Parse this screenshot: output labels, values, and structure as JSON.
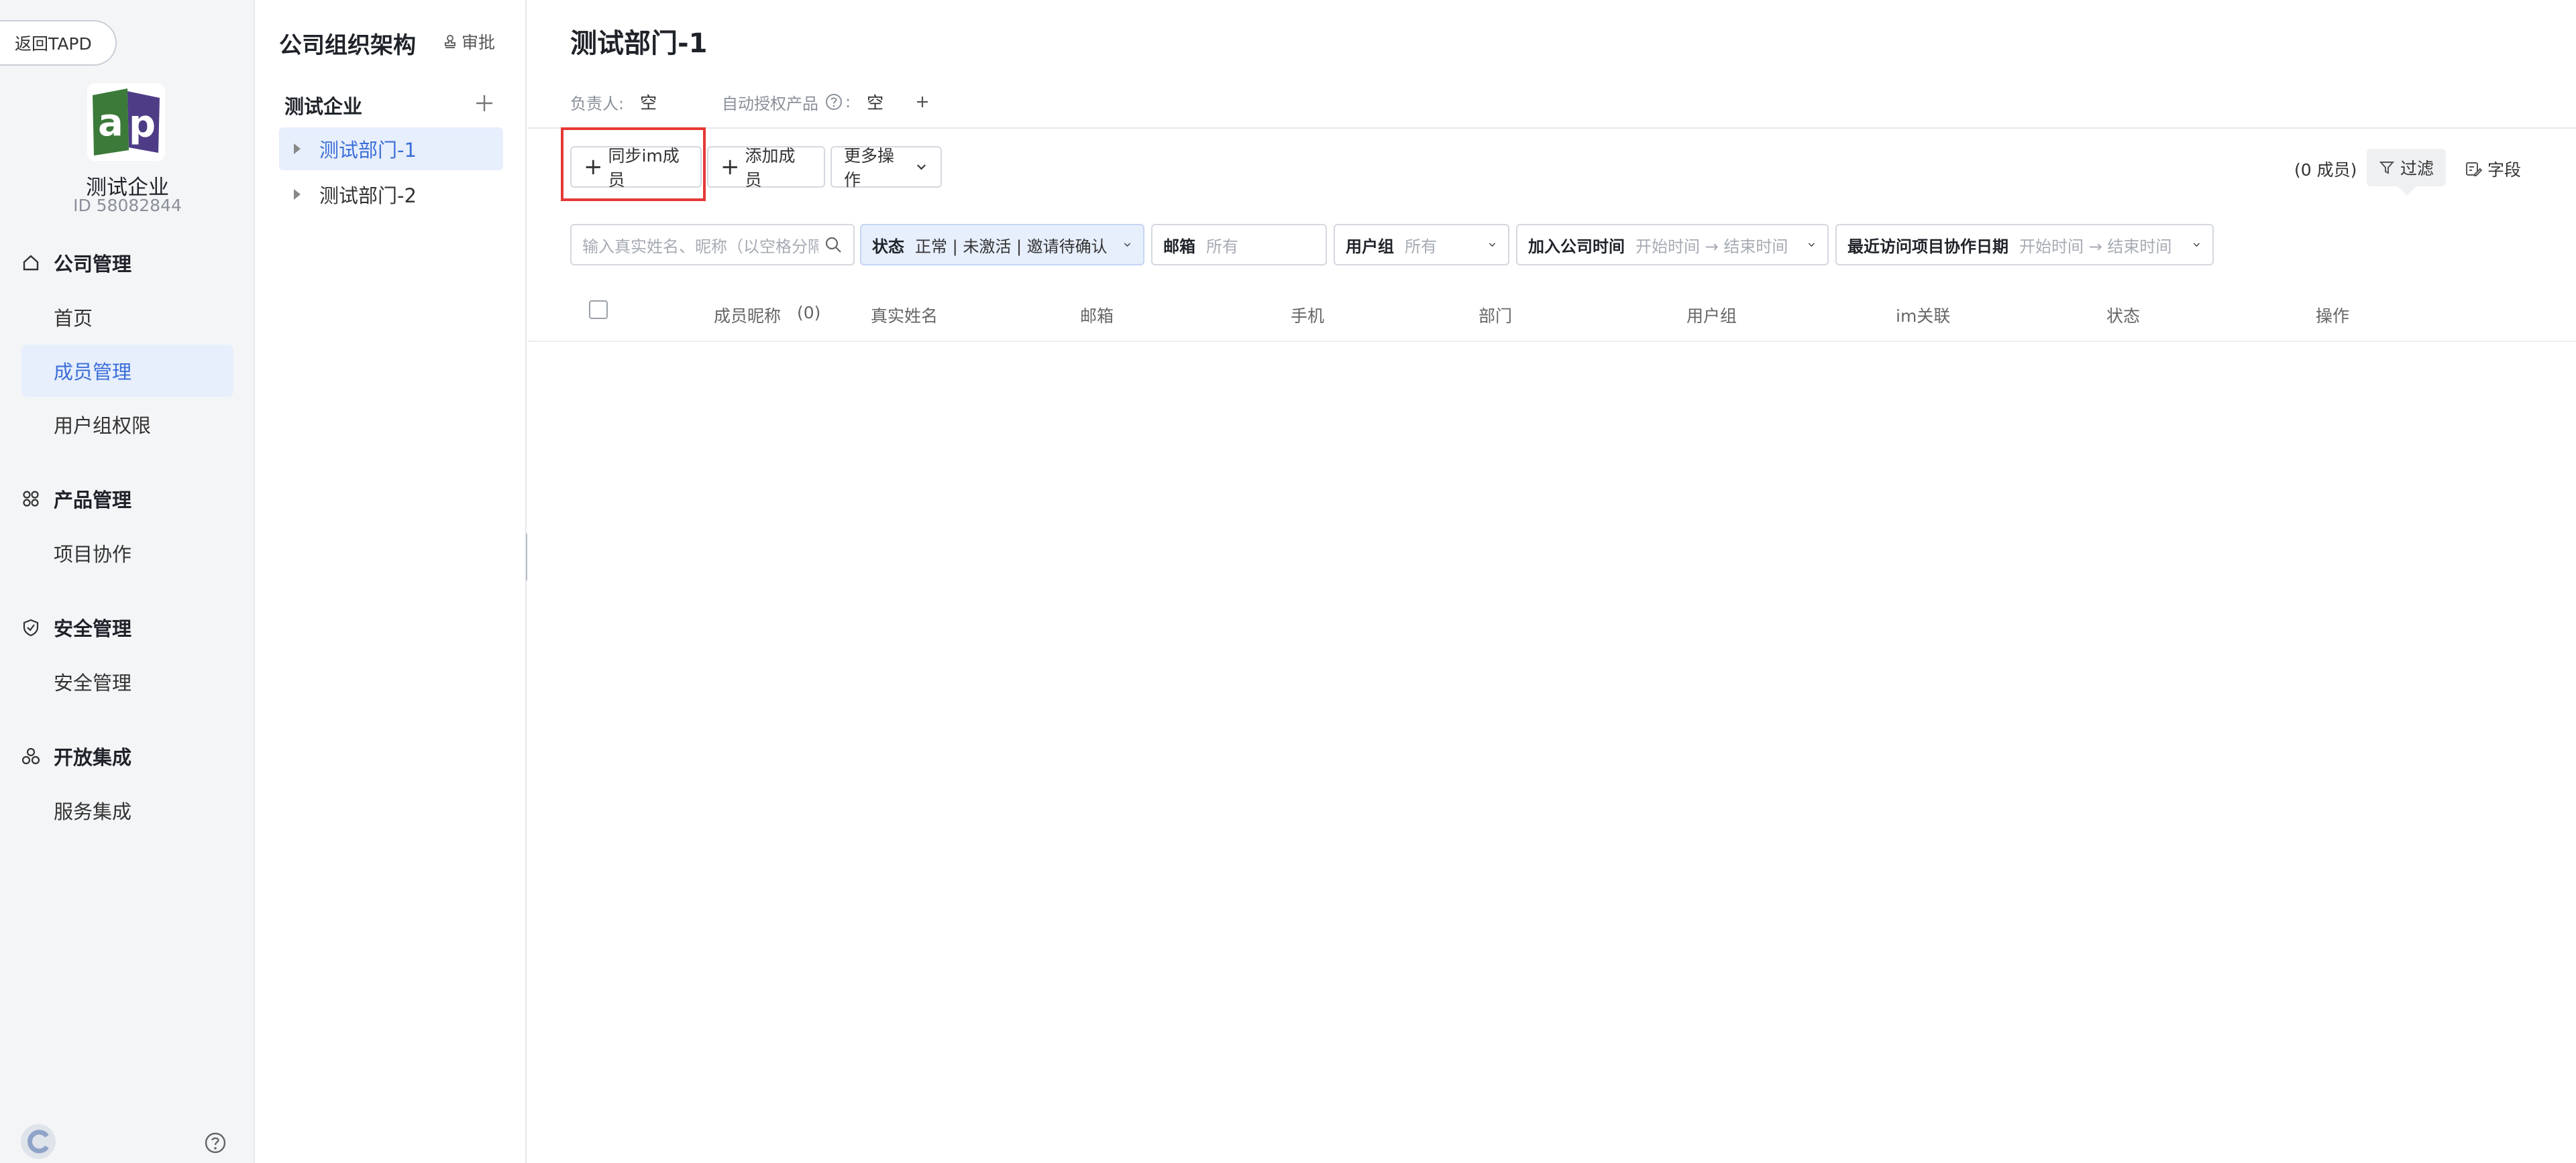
{
  "nav": {
    "back_label": "返回TAPD",
    "org_name": "测试企业",
    "org_id": "ID 58082844",
    "sections": [
      {
        "title": "公司管理",
        "icon": "home-icon",
        "items": [
          "首页",
          "成员管理",
          "用户组权限"
        ]
      },
      {
        "title": "产品管理",
        "icon": "grid-icon",
        "items": [
          "项目协作"
        ]
      },
      {
        "title": "安全管理",
        "icon": "shield-icon",
        "items": [
          "安全管理"
        ]
      },
      {
        "title": "开放集成",
        "icon": "integration-icon",
        "items": [
          "服务集成"
        ]
      }
    ],
    "active_item": "成员管理"
  },
  "tree": {
    "title": "公司组织架构",
    "audit_label": "审批",
    "company": "测试企业",
    "departments": [
      "测试部门-1",
      "测试部门-2"
    ],
    "active_department": "测试部门-1"
  },
  "main": {
    "title": "测试部门-1",
    "owner_label": "负责人:",
    "owner_value": "空",
    "auto_product_label": "自动授权产品",
    "auto_product_value": "空",
    "toolbar": {
      "sync_label": "同步im成员",
      "add_label": "添加成员",
      "more_label": "更多操作",
      "member_count": "(0 成员)",
      "filter_label": "过滤",
      "fields_label": "字段"
    },
    "filters": {
      "search_placeholder": "输入真实姓名、昵称（以空格分隔）",
      "status_label": "状态",
      "status_value": "正常 | 未激活 | 邀请待确认",
      "email_label": "邮箱",
      "email_value": "所有",
      "group_label": "用户组",
      "group_value": "所有",
      "join_label": "加入公司时间",
      "join_value": "开始时间 → 结束时间",
      "visit_label": "最近访问项目协作日期",
      "visit_value": "开始时间 → 结束时间"
    },
    "table": {
      "columns": [
        "成员昵称",
        "(0)",
        "真实姓名",
        "邮箱",
        "手机",
        "部门",
        "用户组",
        "im关联",
        "状态",
        "操作"
      ]
    }
  },
  "colors": {
    "accent": "#3b6fd8",
    "highlight": "#e53935",
    "active_bg": "#e7eefc"
  }
}
